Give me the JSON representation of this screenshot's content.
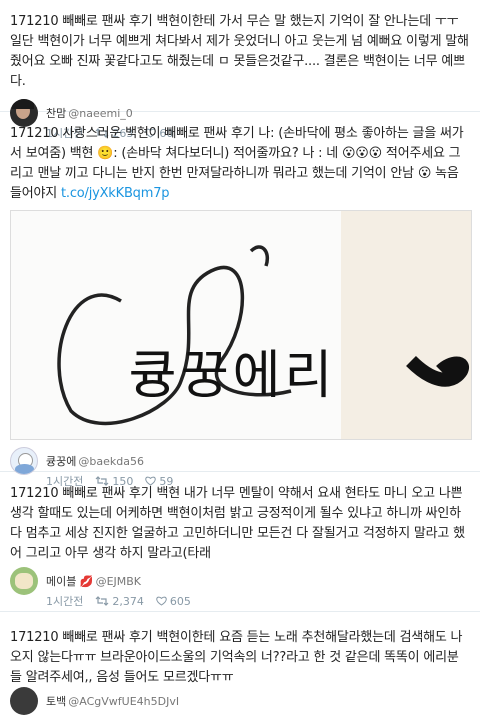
{
  "tweets": [
    {
      "text": "171210 빼빼로 팬싸 후기 백현이한테 가서 무슨 말 했는지 기억이 잘 안나는데 ㅜㅜ 일단 백현이가 너무 예쁘게 쳐다봐서 제가 웃었더니 아고 웃는게 넘 예뻐요 이렇게 말해줬어요 오빠 진짜 꽃같다고도 해줬는데 ㅁ 못들은것같구.... 결론은 백현이는 너무 예쁘다.",
      "name": "찬맘",
      "handle": "@naeemi_0",
      "time": "1시간전",
      "retweets": "263",
      "likes": "60"
    },
    {
      "text": "171210 사랑스러운 백현이 빼빼로 팬싸 후기 나: (손바닥에 평소 좋아하는 글을 써가서 보여줌) 백현 🙂: (손바닥 쳐다보더니) 적어줄까요? 나 : 네 😮😮😮 적어주세요 그리고 맨날 끼고 다니는 반지 한번 만져달라하니까 뭐라고 했는데 기억이 안남 😮 녹음 들어야지",
      "link": "t.co/jyXkKBqm7p",
      "photo_text": "큥꿍에리",
      "name": "큥꿍에",
      "handle": "@baekda56",
      "time": "1시간전",
      "retweets": "150",
      "likes": "59"
    },
    {
      "text": "171210 빼빼로 팬싸 후기 백현 내가 너무 멘탈이 약해서 요새 현타도 마니 오고 나쁜생각 할때도 있는데 어케하면 백현이처럼 밝고 긍정적이게 될수 있냐고 하니까 싸인하다 멈추고 세상 진지한 얼굴하고 고민하더니만 모든건 다 잘될거고 걱정하지 말라고 했어 그리고 아무 생각 하지 말라고(타래",
      "name": "메이블 💋",
      "handle": "@EJMBK",
      "time": "1시간전",
      "retweets": "2,374",
      "likes": "605"
    },
    {
      "text": "171210 빼빼로 팬싸 후기 백현이한테 요즘 듣는 노래 추천해달라했는데 검색해도 나오지 않는다ㅠㅠ 브라운아이드소울의 기억속의 너??라고 한 것 같은데 똑똑이 에리분들 알려주세여,, 음성 들어도 모르겠다ㅠㅠ",
      "name": "토백",
      "handle": "@ACgVwfUE4h5DJvI"
    }
  ],
  "colors": {
    "link": "#1b95e0",
    "meta": "#8899a6",
    "divider": "#e6ecf0"
  },
  "icons": [
    "retweet-icon",
    "heart-icon"
  ]
}
